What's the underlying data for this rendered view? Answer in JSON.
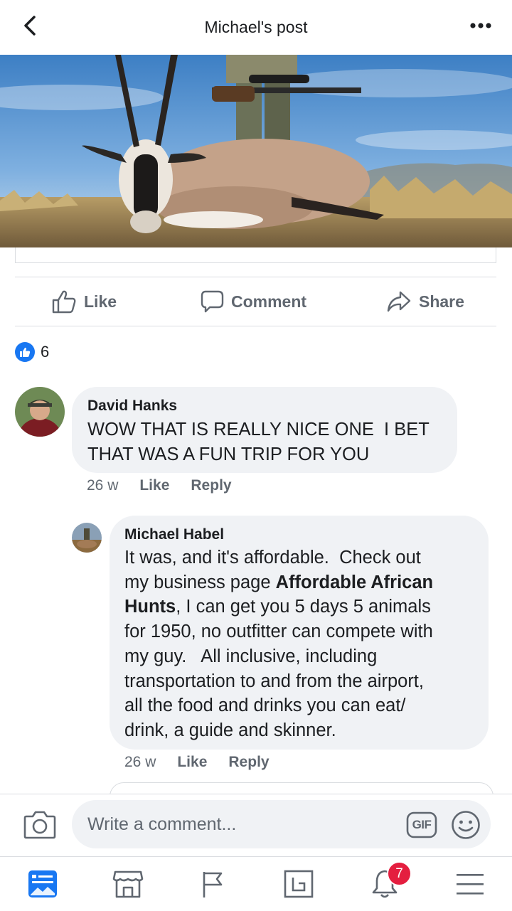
{
  "header": {
    "title": "Michael's post",
    "back_icon": "chevron-left-icon",
    "more_icon": "more-dots-icon"
  },
  "actions": {
    "like": "Like",
    "comment": "Comment",
    "share": "Share"
  },
  "reactions": {
    "count": "6"
  },
  "comments": [
    {
      "author": "David Hanks",
      "lines": [
        "WOW THAT IS REALLY NICE ONE  I BET",
        "THAT WAS A FUN TRIP FOR YOU"
      ],
      "time": "26 w",
      "like": "Like",
      "reply": "Reply"
    },
    {
      "author": "Michael Habel",
      "line1": "It was, and it's affordable.  Check out",
      "line2_pre": "my business page ",
      "line2_bold": "Affordable African",
      "line3_bold": "Hunts",
      "line3_post": ", I can get you 5 days 5 animals",
      "line4": "for 1950, no outfitter can compete with",
      "line5": "my guy.   All inclusive, including",
      "line6": "transportation to and from the airport,",
      "line7": "all the food and drinks you can eat/",
      "line8": "drink, a guide and skinner.",
      "time": "26 w",
      "like": "Like",
      "reply": "Reply"
    }
  ],
  "composer": {
    "placeholder": "Write a comment...",
    "gif": "GIF"
  },
  "tabbar": {
    "notifications_badge": "7"
  },
  "colors": {
    "accent": "#1877f2",
    "badge": "#e41e3f",
    "bubble": "#f0f2f5",
    "muted": "#606770"
  }
}
